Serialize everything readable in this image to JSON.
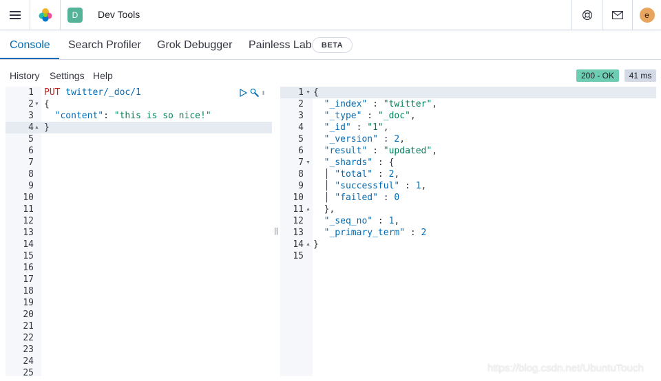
{
  "header": {
    "space_initial": "D",
    "title": "Dev Tools",
    "user_initial": "e",
    "icons": [
      "menu-icon",
      "elastic-logo-icon",
      "help-icon",
      "mail-icon"
    ]
  },
  "tabs": [
    {
      "label": "Console",
      "active": true
    },
    {
      "label": "Search Profiler",
      "active": false
    },
    {
      "label": "Grok Debugger",
      "active": false
    },
    {
      "label": "Painless Lab",
      "active": false
    }
  ],
  "beta_badge": "BETA",
  "menu": {
    "history": "History",
    "settings": "Settings",
    "help": "Help"
  },
  "response_status": {
    "code": "200 - OK",
    "time": "41 ms"
  },
  "request_editor": {
    "line_count": 25,
    "active_line": 4,
    "lines": [
      [
        {
          "t": "PUT",
          "c": "k-method"
        },
        {
          "t": " twitter/_doc/1",
          "c": "k-url"
        }
      ],
      [
        {
          "t": "{",
          "c": "k-punc"
        }
      ],
      [
        {
          "t": "  ",
          "c": "k-punc"
        },
        {
          "t": "\"content\"",
          "c": "k-key"
        },
        {
          "t": ": ",
          "c": "k-punc"
        },
        {
          "t": "\"this is so nice!\"",
          "c": "k-str"
        }
      ],
      [
        {
          "t": "}",
          "c": "k-punc"
        }
      ]
    ],
    "fold_markers": {
      "2": "▼",
      "4": "▲"
    }
  },
  "response_editor": {
    "line_count": 15,
    "active_line": 1,
    "lines": [
      [
        {
          "t": "{",
          "c": "k-punc"
        }
      ],
      [
        {
          "t": "  ",
          "c": "k-punc"
        },
        {
          "t": "\"_index\"",
          "c": "k-key"
        },
        {
          "t": " : ",
          "c": "k-punc"
        },
        {
          "t": "\"twitter\"",
          "c": "k-str"
        },
        {
          "t": ",",
          "c": "k-punc"
        }
      ],
      [
        {
          "t": "  ",
          "c": "k-punc"
        },
        {
          "t": "\"_type\"",
          "c": "k-key"
        },
        {
          "t": " : ",
          "c": "k-punc"
        },
        {
          "t": "\"_doc\"",
          "c": "k-str"
        },
        {
          "t": ",",
          "c": "k-punc"
        }
      ],
      [
        {
          "t": "  ",
          "c": "k-punc"
        },
        {
          "t": "\"_id\"",
          "c": "k-key"
        },
        {
          "t": " : ",
          "c": "k-punc"
        },
        {
          "t": "\"1\"",
          "c": "k-str"
        },
        {
          "t": ",",
          "c": "k-punc"
        }
      ],
      [
        {
          "t": "  ",
          "c": "k-punc"
        },
        {
          "t": "\"_version\"",
          "c": "k-key"
        },
        {
          "t": " : ",
          "c": "k-punc"
        },
        {
          "t": "2",
          "c": "k-num"
        },
        {
          "t": ",",
          "c": "k-punc"
        }
      ],
      [
        {
          "t": "  ",
          "c": "k-punc"
        },
        {
          "t": "\"result\"",
          "c": "k-key"
        },
        {
          "t": " : ",
          "c": "k-punc"
        },
        {
          "t": "\"updated\"",
          "c": "k-str"
        },
        {
          "t": ",",
          "c": "k-punc"
        }
      ],
      [
        {
          "t": "  ",
          "c": "k-punc"
        },
        {
          "t": "\"_shards\"",
          "c": "k-key"
        },
        {
          "t": " : {",
          "c": "k-punc"
        }
      ],
      [
        {
          "t": "  │ ",
          "c": "k-punc"
        },
        {
          "t": "\"total\"",
          "c": "k-key"
        },
        {
          "t": " : ",
          "c": "k-punc"
        },
        {
          "t": "2",
          "c": "k-num"
        },
        {
          "t": ",",
          "c": "k-punc"
        }
      ],
      [
        {
          "t": "  │ ",
          "c": "k-punc"
        },
        {
          "t": "\"successful\"",
          "c": "k-key"
        },
        {
          "t": " : ",
          "c": "k-punc"
        },
        {
          "t": "1",
          "c": "k-num"
        },
        {
          "t": ",",
          "c": "k-punc"
        }
      ],
      [
        {
          "t": "  │ ",
          "c": "k-punc"
        },
        {
          "t": "\"failed\"",
          "c": "k-key"
        },
        {
          "t": " : ",
          "c": "k-punc"
        },
        {
          "t": "0",
          "c": "k-num"
        }
      ],
      [
        {
          "t": "  },",
          "c": "k-punc"
        }
      ],
      [
        {
          "t": "  ",
          "c": "k-punc"
        },
        {
          "t": "\"_seq_no\"",
          "c": "k-key"
        },
        {
          "t": " : ",
          "c": "k-punc"
        },
        {
          "t": "1",
          "c": "k-num"
        },
        {
          "t": ",",
          "c": "k-punc"
        }
      ],
      [
        {
          "t": "  ",
          "c": "k-punc"
        },
        {
          "t": "\"_primary_term\"",
          "c": "k-key"
        },
        {
          "t": " : ",
          "c": "k-punc"
        },
        {
          "t": "2",
          "c": "k-num"
        }
      ],
      [
        {
          "t": "}",
          "c": "k-punc"
        }
      ]
    ],
    "fold_markers": {
      "1": "▼",
      "7": "▼",
      "11": "▲",
      "14": "▲"
    }
  },
  "watermark": "https://blog.csdn.net/UbuntuTouch",
  "colors": {
    "accent": "#006bb4",
    "status_ok": "#6dccb1",
    "space_badge": "#54b399",
    "avatar": "#e7a55f"
  }
}
